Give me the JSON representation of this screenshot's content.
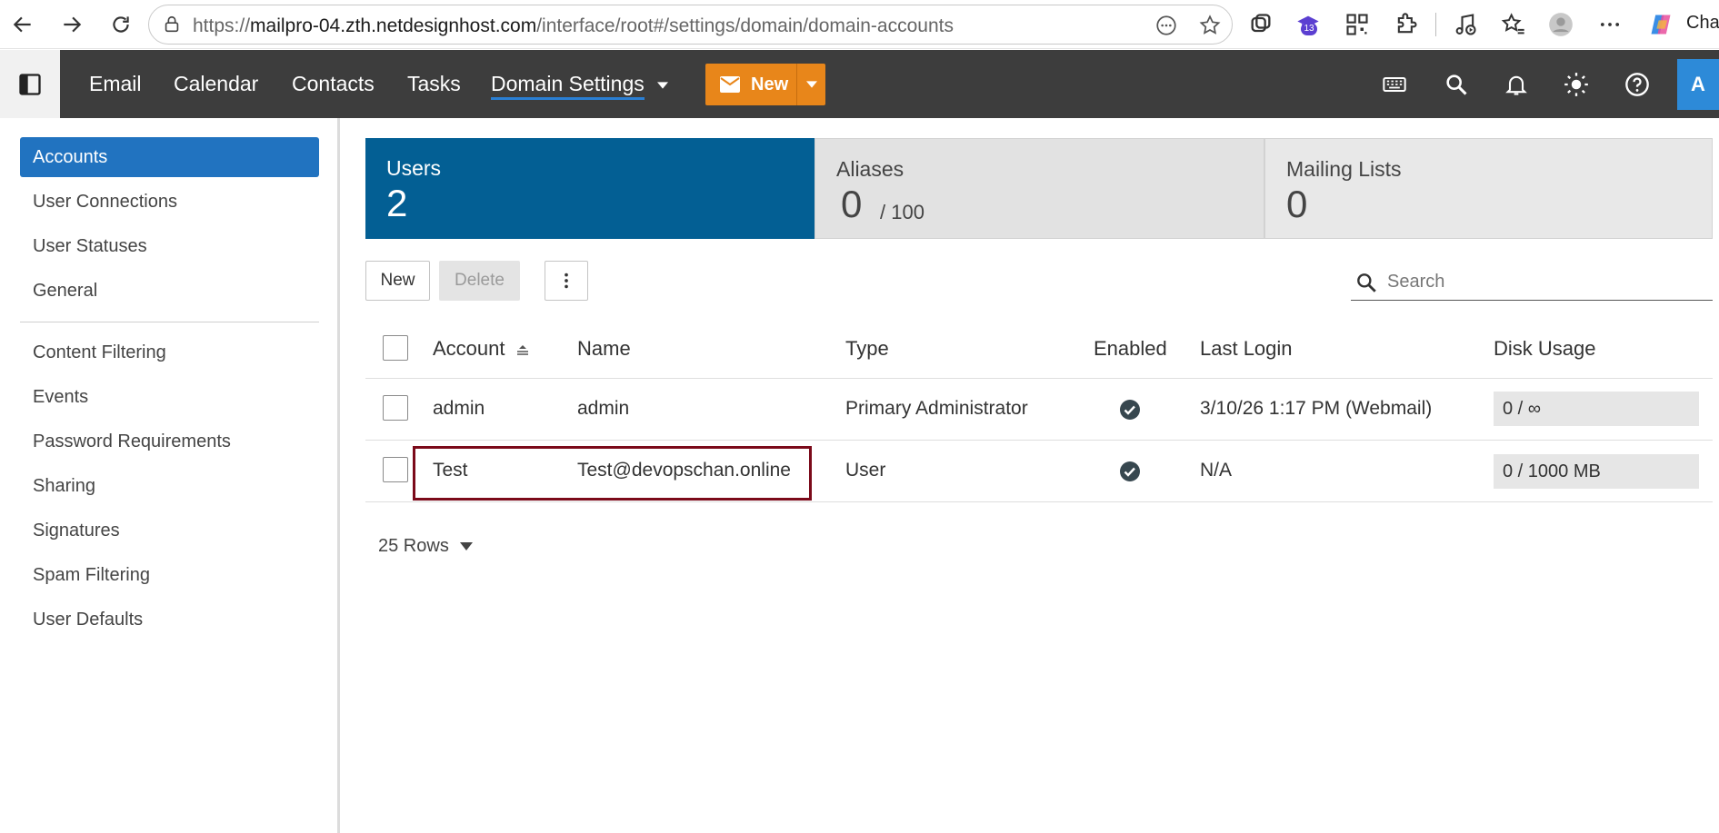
{
  "browser": {
    "url_prefix": "https://",
    "url_host": "mailpro-04.zth.netdesignhost.com",
    "url_path": "/interface/root#/settings/domain/domain-accounts",
    "extension_badge": "13",
    "copilot_label": "Chat"
  },
  "header": {
    "nav": [
      "Email",
      "Calendar",
      "Contacts",
      "Tasks",
      "Domain Settings"
    ],
    "new_label": "New",
    "avatar_letter": "A"
  },
  "sidebar": {
    "items_top": [
      "Accounts",
      "User Connections",
      "User Statuses",
      "General"
    ],
    "items_bottom": [
      "Content Filtering",
      "Events",
      "Password Requirements",
      "Sharing",
      "Signatures",
      "Spam Filtering",
      "User Defaults"
    ]
  },
  "stats": {
    "users": {
      "label": "Users",
      "value": "2"
    },
    "aliases": {
      "label": "Aliases",
      "value": "0",
      "limit": "/ 100"
    },
    "mailing_lists": {
      "label": "Mailing Lists",
      "value": "0"
    }
  },
  "toolbar": {
    "new_label": "New",
    "delete_label": "Delete",
    "search_placeholder": "Search"
  },
  "table": {
    "columns": [
      "Account",
      "Name",
      "Type",
      "Enabled",
      "Last Login",
      "Disk Usage"
    ],
    "rows": [
      {
        "account": "admin",
        "name": "admin",
        "type": "Primary Administrator",
        "enabled": true,
        "last_login": "3/10/26 1:17 PM (Webmail)",
        "disk_usage": "0 / ∞"
      },
      {
        "account": "Test",
        "name": "Test@devopschan.online",
        "type": "User",
        "enabled": true,
        "last_login": "N/A",
        "disk_usage": "0 / 1000 MB"
      }
    ]
  },
  "pager": {
    "rows_label": "25 Rows"
  },
  "colors": {
    "accent": "#2173c0",
    "users_tile": "#035f94",
    "new_button": "#e8861a",
    "highlight": "#7b0a1a"
  }
}
